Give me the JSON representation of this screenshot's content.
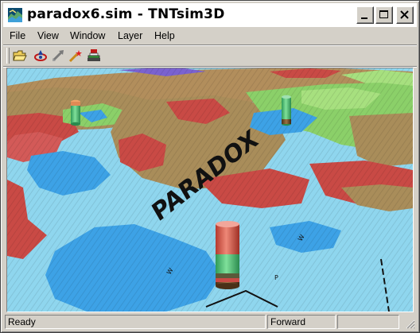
{
  "window": {
    "title": "paradox6.sim - TNTsim3D"
  },
  "titlebar_buttons": {
    "minimize_icon": "minimize-icon",
    "maximize_icon": "maximize-icon",
    "close_icon": "close-icon"
  },
  "menu": {
    "items": [
      {
        "label": "File"
      },
      {
        "label": "View"
      },
      {
        "label": "Window"
      },
      {
        "label": "Layer"
      },
      {
        "label": "Help"
      }
    ]
  },
  "toolbar": {
    "buttons": [
      {
        "icon": "open-folder-icon"
      },
      {
        "icon": "viewer-position-icon"
      },
      {
        "icon": "flight-direction-icon"
      },
      {
        "icon": "laser-pointer-icon"
      },
      {
        "icon": "layer-manager-icon"
      }
    ]
  },
  "scene": {
    "label": "PARADOX",
    "label_color": "#111111",
    "colors": {
      "water": "#8fd6ee",
      "lake": "#3da2e6",
      "red_unit": "#c94a45",
      "tan_unit": "#a98d5a",
      "green_unit": "#8bd069",
      "light_green": "#a7e07f"
    }
  },
  "status": {
    "message": "Ready",
    "mode": "Forward",
    "extra": ""
  }
}
